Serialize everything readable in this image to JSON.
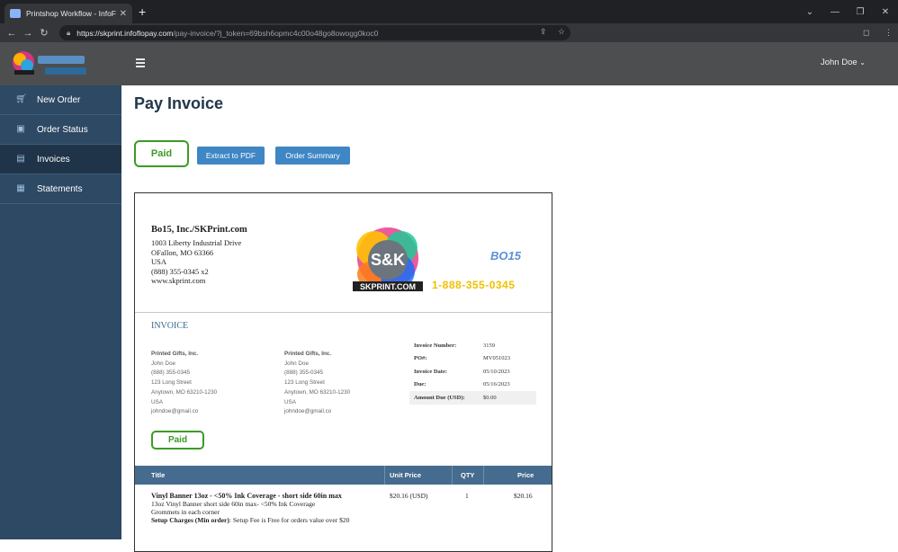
{
  "browser": {
    "tab_title": "Printshop Workflow - InfoFlo Pay",
    "url_host": "https://skprint.infoflopay.com",
    "url_path": "/pay-invoice/?j_token=69bsh6opmc4c00o48go8owogg0koc0"
  },
  "header": {
    "user": "John Doe"
  },
  "sidebar": {
    "items": [
      {
        "label": "New Order"
      },
      {
        "label": "Order Status"
      },
      {
        "label": "Invoices"
      },
      {
        "label": "Statements"
      }
    ]
  },
  "page": {
    "title": "Pay Invoice",
    "status": "Paid",
    "extract_btn": "Extract to PDF",
    "summary_btn": "Order Summary"
  },
  "invoice": {
    "company": {
      "name": "Bo15, Inc./SKPrint.com",
      "lines": [
        "1003 Liberty Industrial Drive",
        "OFallon, MO 63366",
        "USA",
        "(888) 355-0345 x2",
        "www.skprint.com"
      ]
    },
    "logo": {
      "phone": "1-888-355-0345",
      "brand_text": "SKPRINT.COM",
      "mark": "S&K",
      "bo": "BO15"
    },
    "label": "INVOICE",
    "bill_to": {
      "name": "Printed Gifts, Inc.",
      "lines": [
        "John Doe",
        "(888) 355-0345",
        "123 Long Street",
        "Anytown, MO 63210-1230",
        "USA",
        "johndoe@gmail.co"
      ]
    },
    "ship_to": {
      "name": "Printed Gifts, Inc.",
      "lines": [
        "John Doe",
        "(888) 355-0345",
        "123 Long Street",
        "Anytown, MO 63210-1230",
        "USA",
        "johndoe@gmail.co"
      ]
    },
    "meta": [
      {
        "key": "Invoice Number:",
        "value": "3159"
      },
      {
        "key": "PO#:",
        "value": "MV051023"
      },
      {
        "key": "Invoice Date:",
        "value": "05/10/2023"
      },
      {
        "key": "Due:",
        "value": "05/16/2023"
      },
      {
        "key": "Amount Due (USD):",
        "value": "$0.00"
      }
    ],
    "paid_label": "Paid",
    "table": {
      "headers": {
        "title": "Title",
        "unit_price": "Unit Price",
        "qty": "QTY",
        "price": "Price"
      },
      "rows": [
        {
          "title": "Vinyl Banner 13oz - <50% Ink Coverage - short side 60in max",
          "desc1": "13oz Vinyl Banner short side 60in max- <50% Ink Coverage",
          "desc2": "Grommets in each corner",
          "setup_label": "Setup Charges (Min order)",
          "setup_text": ": Setup Fee is Free for orders value over $20",
          "unit_price": "$20.16 (USD)",
          "qty": "1",
          "price": "$20.16"
        }
      ]
    }
  }
}
